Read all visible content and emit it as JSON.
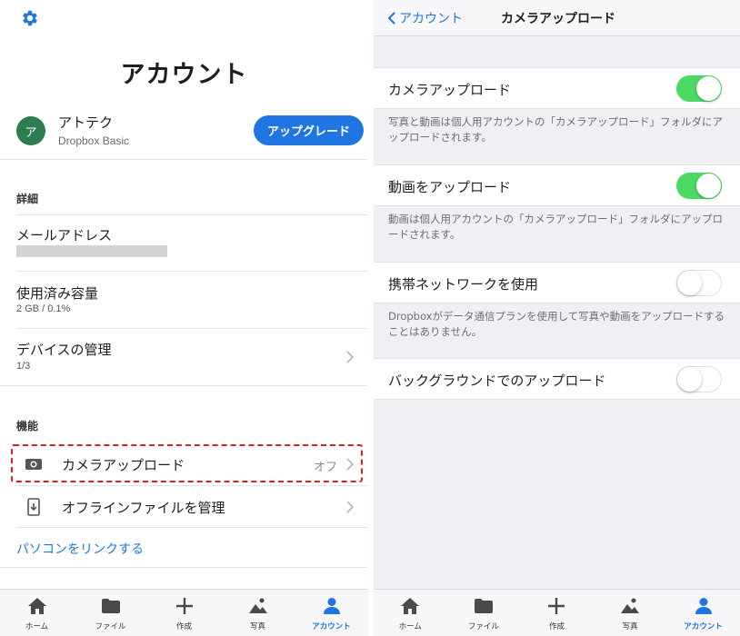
{
  "left": {
    "title": "アカウント",
    "profile": {
      "avatar_initial": "ア",
      "name": "アトテク",
      "plan": "Dropbox Basic",
      "upgrade_label": "アップグレード"
    },
    "details_section": "詳細",
    "email_label": "メールアドレス",
    "storage_label": "使用済み容量",
    "storage_value": "2 GB / 0.1%",
    "devices_label": "デバイスの管理",
    "devices_value": "1/3",
    "features_section": "機能",
    "camera_upload_label": "カメラアップロード",
    "camera_upload_value": "オフ",
    "offline_files_label": "オフラインファイルを管理",
    "link_pc_label": "パソコンをリンクする"
  },
  "right": {
    "back_label": "アカウント",
    "nav_title": "カメラアップロード",
    "settings": [
      {
        "label": "カメラアップロード",
        "on": true,
        "note": "写真と動画は個人用アカウントの「カメラアップロード」フォルダにアップロードされます。"
      },
      {
        "label": "動画をアップロード",
        "on": true,
        "note": "動画は個人用アカウントの「カメラアップロード」フォルダにアップロードされます。"
      },
      {
        "label": "携帯ネットワークを使用",
        "on": false,
        "note": "Dropboxがデータ通信プランを使用して写真や動画をアップロードすることはありません。"
      },
      {
        "label": "バックグラウンドでのアップロード",
        "on": false,
        "note": ""
      }
    ]
  },
  "tabs": [
    {
      "label": "ホーム",
      "icon": "home-icon",
      "active": false
    },
    {
      "label": "ファイル",
      "icon": "folder-icon",
      "active": false
    },
    {
      "label": "作成",
      "icon": "plus-icon",
      "active": false
    },
    {
      "label": "写真",
      "icon": "photo-icon",
      "active": false
    },
    {
      "label": "アカウント",
      "icon": "person-icon",
      "active": true
    }
  ],
  "colors": {
    "accent": "#1f76e2",
    "toggle_on": "#4cd964",
    "highlight": "#e01e1e",
    "avatar_bg": "#2e7d4f"
  }
}
